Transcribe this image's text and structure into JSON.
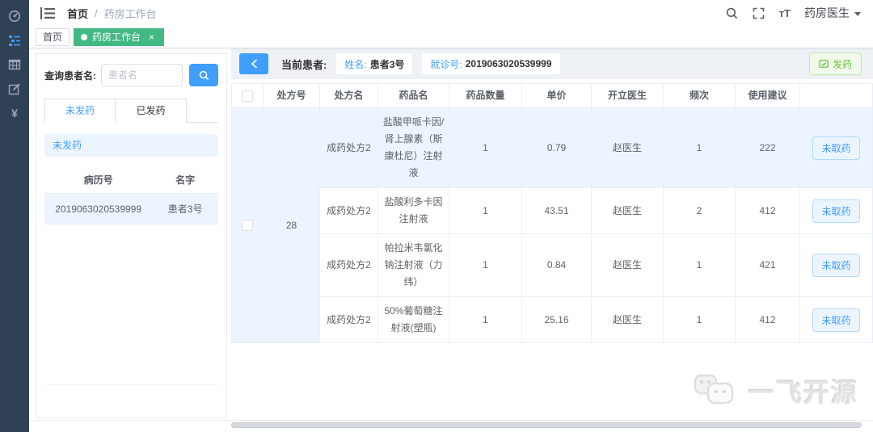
{
  "navbar": {
    "breadcrumb": {
      "root": "首页",
      "separator": "/",
      "current": "药房工作台"
    },
    "font_size_icon_text": "тT",
    "user_menu": "药房医生"
  },
  "tags": [
    {
      "label": "首页",
      "active": false
    },
    {
      "label": "药房工作台",
      "active": true,
      "close_glyph": "×"
    }
  ],
  "sidebar": {
    "items": [
      {
        "name": "dashboard",
        "icon": "gauge-icon",
        "active": false
      },
      {
        "name": "pharmacy-worklist",
        "icon": "list-icon",
        "active": true
      },
      {
        "name": "data-tables",
        "icon": "grid-icon",
        "active": false
      },
      {
        "name": "registration",
        "icon": "edit-icon",
        "active": false
      },
      {
        "name": "billing",
        "icon": "yuan-icon",
        "glyph": "¥",
        "active": false
      }
    ]
  },
  "left_panel": {
    "search_label": "查询患者名:",
    "search_placeholder": "患者名",
    "tabs": [
      {
        "label": "未发药",
        "active": true
      },
      {
        "label": "已发药",
        "active": false
      }
    ],
    "group_banner": "未发药",
    "patient_table": {
      "headers": [
        "病历号",
        "名字"
      ],
      "rows": [
        {
          "record_no": "2019063020539999",
          "name": "患者3号"
        }
      ]
    }
  },
  "main": {
    "current_patient_label": "当前患者:",
    "name_label": "姓名:",
    "name_value": "患者3号",
    "visit_label": "就诊号:",
    "visit_value": "2019063020539999",
    "dispense_button_label": "发药",
    "table": {
      "headers": [
        "处方号",
        "处方名",
        "药品名",
        "药品数量",
        "单价",
        "开立医生",
        "频次",
        "使用建议"
      ],
      "prescription_no": "28",
      "rows": [
        {
          "prescription_name": "成药处方2",
          "drug_name": "盐酸甲哌卡因/肾上腺素（斯康杜尼）注射液",
          "quantity": "1",
          "unit_price": "0.79",
          "doctor": "赵医生",
          "frequency": "1",
          "usage_advice": "222",
          "status_label": "未取药"
        },
        {
          "prescription_name": "成药处方2",
          "drug_name": "盐酸利多卡因注射液",
          "quantity": "1",
          "unit_price": "43.51",
          "doctor": "赵医生",
          "frequency": "2",
          "usage_advice": "412",
          "status_label": "未取药"
        },
        {
          "prescription_name": "成药处方2",
          "drug_name": "帕拉米韦氯化钠注射液（力纬）",
          "quantity": "1",
          "unit_price": "0.84",
          "doctor": "赵医生",
          "frequency": "1",
          "usage_advice": "421",
          "status_label": "未取药"
        },
        {
          "prescription_name": "成药处方2",
          "drug_name": "50%葡萄糖注射液(塑瓶)",
          "quantity": "1",
          "unit_price": "25.16",
          "doctor": "赵医生",
          "frequency": "1",
          "usage_advice": "412",
          "status_label": "未取药"
        }
      ]
    }
  },
  "watermark": {
    "text": "一飞开源"
  },
  "colors": {
    "accent_blue": "#409eff",
    "tag_green": "#42b983",
    "sidebar_bg": "#304156",
    "row_highlight": "#ecf5ff",
    "success_green": "#67c23a",
    "band_bg": "#eef1f6"
  }
}
